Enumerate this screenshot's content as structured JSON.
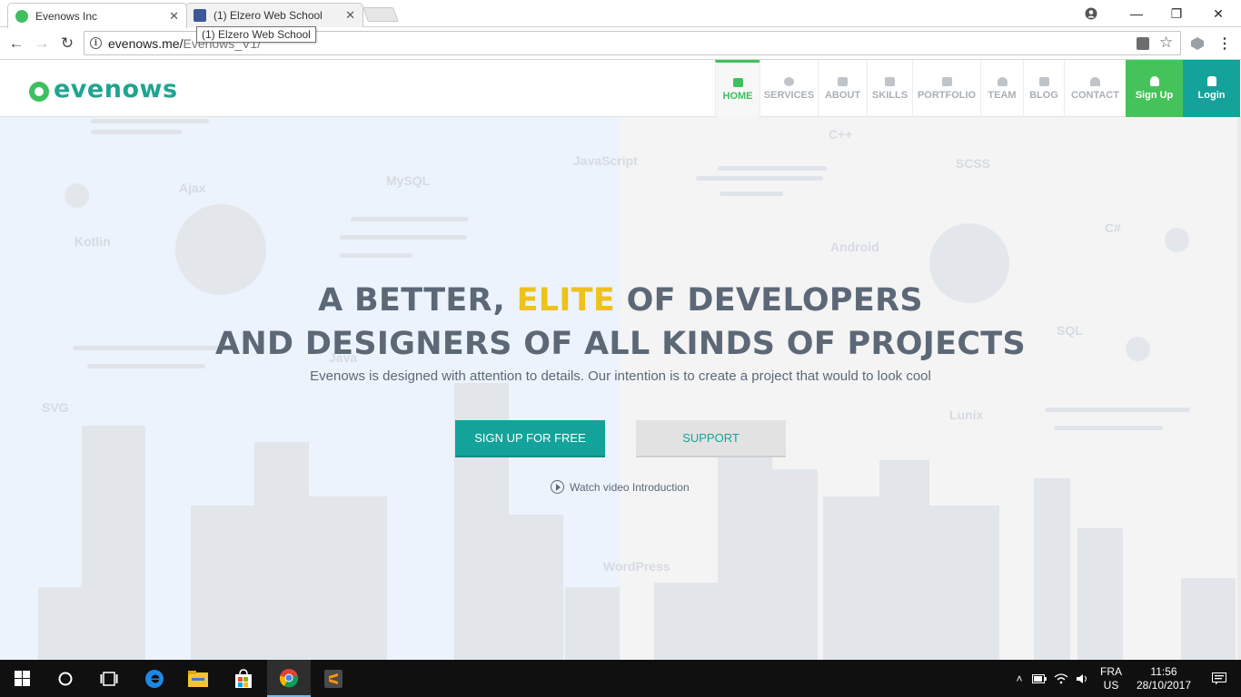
{
  "browser": {
    "tabs": [
      {
        "title": "Evenows Inc",
        "active": true,
        "favicon": "evenows-favicon"
      },
      {
        "title": "(1) Elzero Web School",
        "active": false,
        "favicon": "facebook-favicon"
      }
    ],
    "tooltip": "(1) Elzero Web School",
    "url_host": "evenows.me/",
    "url_path": "Evenows_V1/",
    "window_controls": {
      "minimize": "—",
      "restore": "❐",
      "close": "✕"
    },
    "nav_glyphs": {
      "back": "←",
      "forward": "→",
      "reload": "↻",
      "bookmark": "☆"
    }
  },
  "site": {
    "logo_text": "evenows",
    "nav": [
      {
        "label": "HOME",
        "icon": "home-icon",
        "active": true
      },
      {
        "label": "SERVICES",
        "icon": "gear-icon"
      },
      {
        "label": "ABOUT",
        "icon": "document-icon"
      },
      {
        "label": "SKILLS",
        "icon": "list-icon"
      },
      {
        "label": "PORTFOLIO",
        "icon": "briefcase-icon"
      },
      {
        "label": "TEAM",
        "icon": "team-icon"
      },
      {
        "label": "BLOG",
        "icon": "blog-icon"
      },
      {
        "label": "CONTACT",
        "icon": "contact-icon"
      }
    ],
    "signup_label": "Sign Up",
    "login_label": "Login"
  },
  "hero": {
    "headline1_a": "A BETTER, ",
    "headline1_elite": "ELITE",
    "headline1_b": " OF DEVELOPERS",
    "headline2": "AND DESIGNERS OF ALL KINDS OF PROJECTS",
    "subtitle": "Evenows is designed with attention to details. Our intention is to create a project that would to look cool",
    "primary_button": "SIGN UP FOR FREE",
    "secondary_button": "SUPPORT",
    "video_link": "Watch video Introduction",
    "background_words": [
      "C++",
      "JavaScript",
      "MySQL",
      "Ajax",
      "SCSS",
      "Kotlin",
      "Android",
      "C#",
      "SQL",
      "SVG",
      "Java",
      "Lunix",
      "WordPress"
    ]
  },
  "taskbar": {
    "lang_top": "FRA",
    "lang_bottom": "US",
    "time": "11:56",
    "date": "28/10/2017"
  },
  "colors": {
    "accent_green": "#3fbf5f",
    "accent_teal": "#14a39a",
    "elite_yellow": "#efc21b",
    "heading_gray": "#5d6877"
  }
}
